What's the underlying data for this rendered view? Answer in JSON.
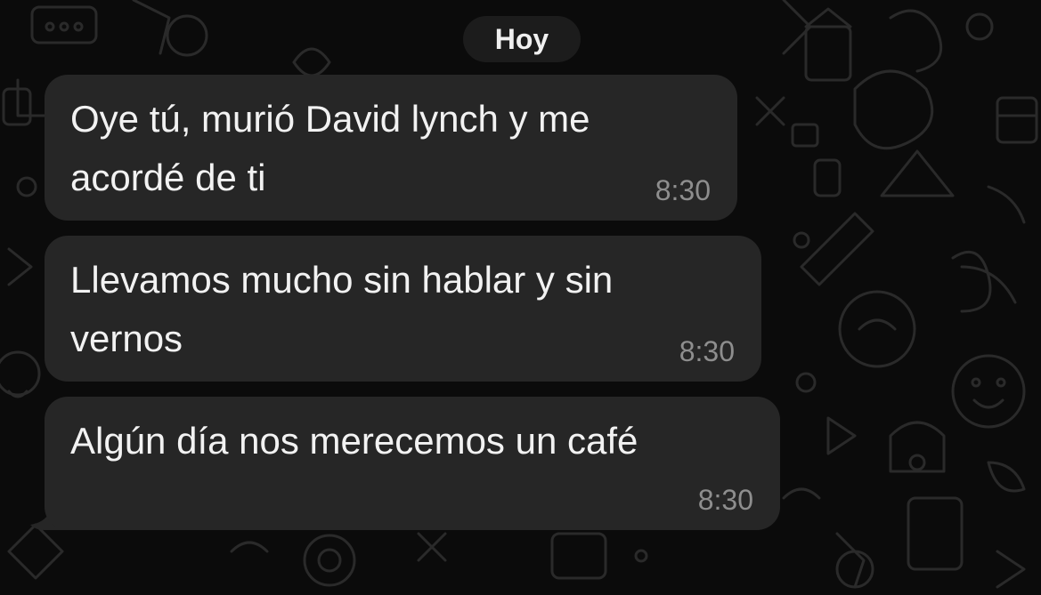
{
  "chat": {
    "date_separator": "Hoy",
    "messages": [
      {
        "text": "Oye tú, murió David lynch y me\nacordé de ti",
        "time": "8:30"
      },
      {
        "text": "Llevamos mucho sin hablar y sin\nvernos",
        "time": "8:30"
      },
      {
        "text": "Algún día nos merecemos un café",
        "time": "8:30"
      }
    ]
  },
  "colors": {
    "background": "#0b0b0b",
    "bubble": "#262626",
    "date_chip": "#1c1c1c",
    "text": "#f2f2f2",
    "timestamp": "#8e8e8e",
    "wallpaper_doodle": "#2a2a2a"
  }
}
